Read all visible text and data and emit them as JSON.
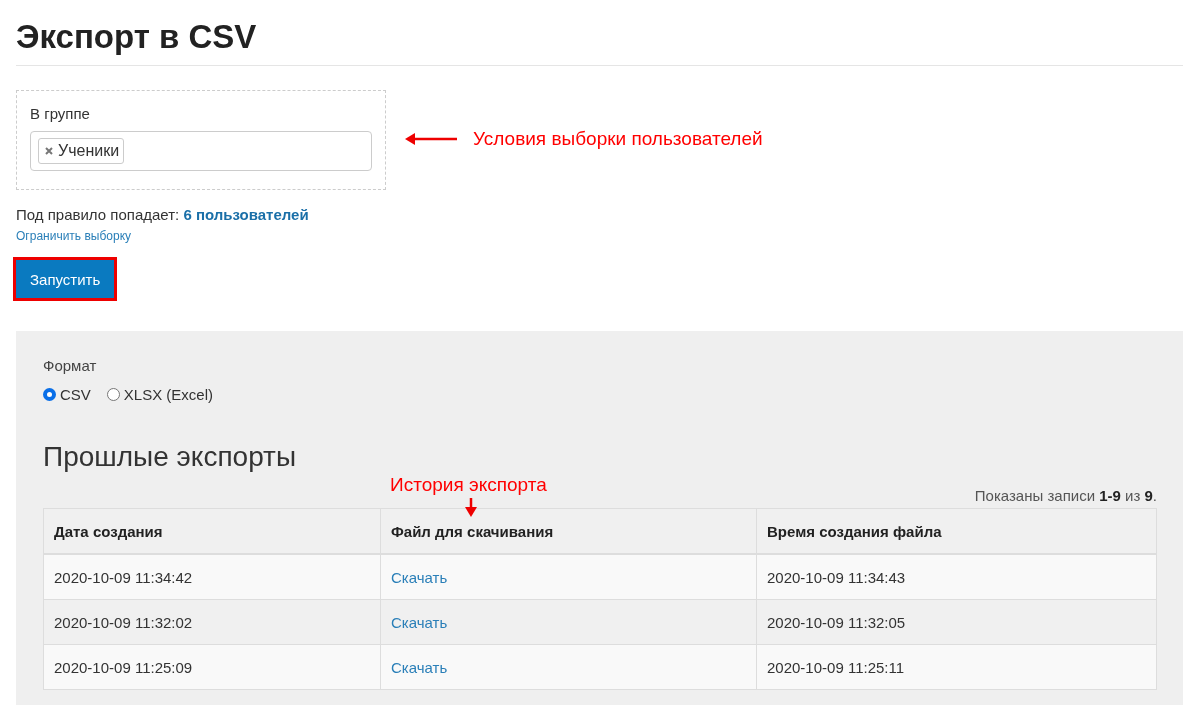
{
  "title": "Экспорт в CSV",
  "filter": {
    "label": "В группе",
    "tags": [
      {
        "label": "Ученики"
      }
    ]
  },
  "match": {
    "prefix": "Под правило попадает:",
    "count_link": "6 пользователей"
  },
  "limit_link": "Ограничить выборку",
  "run_button": "Запустить",
  "annotations": [
    {
      "kind": "left",
      "text": "Условия выборки пользователей"
    },
    {
      "kind": "down",
      "text": "История экспорта"
    }
  ],
  "format": {
    "label": "Формат",
    "options": [
      {
        "label": "CSV",
        "selected": true
      },
      {
        "label": "XLSX (Excel)",
        "selected": false
      }
    ]
  },
  "history": {
    "heading": "Прошлые экспорты",
    "summary": "Показаны записи **1-9** из **9**.",
    "columns": [
      "Дата создания",
      "Файл для скачивания",
      "Время создания файла"
    ],
    "rows": [
      [
        "2020-10-09 11:34:42",
        "Скачать",
        "2020-10-09 11:34:43"
      ],
      [
        "2020-10-09 11:32:02",
        "Скачать",
        "2020-10-09 11:32:05"
      ],
      [
        "2020-10-09 11:25:09",
        "Скачать",
        "2020-10-09 11:25:11"
      ]
    ]
  }
}
